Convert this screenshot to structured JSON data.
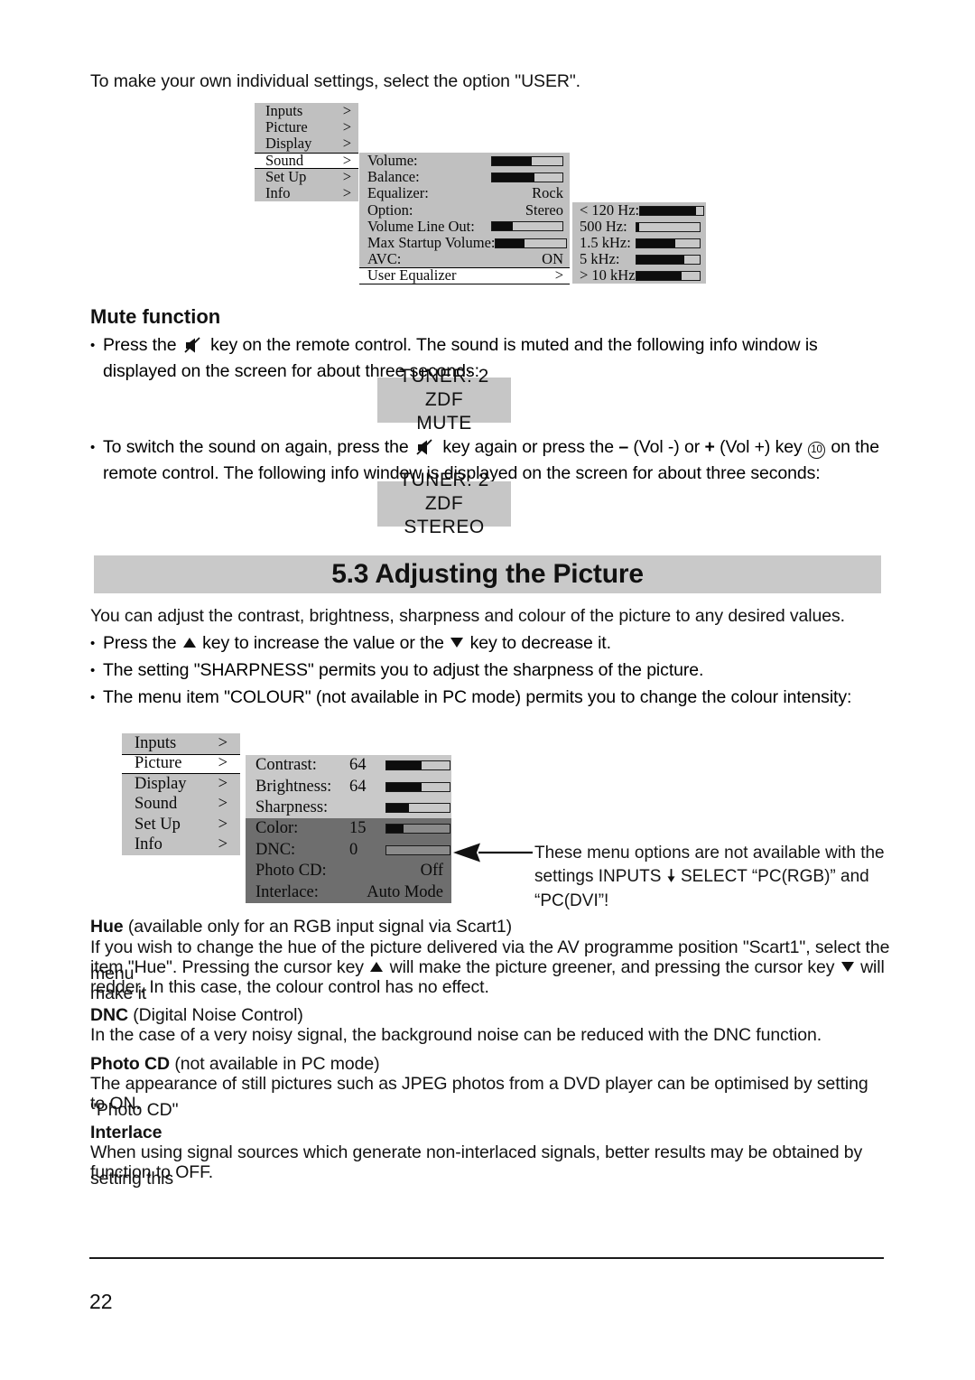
{
  "intro": {
    "line": "To make your own individual settings, select the option \"USER\"."
  },
  "sound_osd": {
    "main_menu": [
      {
        "label": "Inputs",
        "chev": ">"
      },
      {
        "label": "Picture",
        "chev": ">"
      },
      {
        "label": "Display",
        "chev": ">"
      },
      {
        "label": "Sound",
        "chev": ">"
      },
      {
        "label": "Set Up",
        "chev": ">"
      },
      {
        "label": "Info",
        "chev": ">"
      }
    ],
    "selected_item": "Sound",
    "sound_panel": [
      {
        "label": "Volume:",
        "value": "",
        "slider": 56
      },
      {
        "label": "Balance:",
        "value": "",
        "slider": 60
      },
      {
        "label": "Equalizer:",
        "value": "Rock",
        "slider": null
      },
      {
        "label": "Option:",
        "value": "Stereo",
        "slider": null
      },
      {
        "label": "Volume Line Out:",
        "value": "",
        "slider": 30
      },
      {
        "label": "Max Startup Volume:",
        "value": "",
        "slider": 40
      },
      {
        "label": "AVC:",
        "value": "ON",
        "slider": null
      },
      {
        "label": "User Equalizer",
        "value": ">",
        "slider": null,
        "selected": true
      }
    ],
    "equalizer_panel": [
      {
        "label": "< 120 Hz:",
        "slider": 88
      },
      {
        "label": "500 Hz:",
        "slider": 4
      },
      {
        "label": "1.5 kHz:",
        "slider": 62
      },
      {
        "label": "5 kHz:",
        "slider": 75
      },
      {
        "label": "> 10 kHz",
        "slider": 72
      }
    ]
  },
  "mute_section": {
    "heading": "Mute function",
    "bullet1_a": "Press the",
    "bullet1_b": "key on the remote control. The sound is muted and the following info window is displayed on the screen for about three seconds:",
    "mute_window": {
      "line1": "TUNER:  2  ZDF",
      "line2": "MUTE"
    },
    "bullet2_a": "To switch the sound on again, press the",
    "bullet2_b": "key again or press the",
    "bullet2_minus": "–",
    "bullet2_c": "(Vol -) or",
    "bullet2_plus": "+",
    "bullet2_d": "(Vol +) key",
    "bullet2_keynum": "10",
    "bullet2_e": "on the remote control. The following info window is displayed on the screen for about three seconds:",
    "stereo_window": {
      "line1": "TUNER:  2  ZDF",
      "line2": "STEREO"
    }
  },
  "section": {
    "banner_title": "5.3 Adjusting the Picture",
    "intro": "You can adjust the contrast, brightness, sharpness and colour of the picture to any desired values.",
    "b1_a": "Press the",
    "b1_b": "key to increase the value or the",
    "b1_c": "key to decrease it.",
    "b2": "The setting \"SHARPNESS\" permits you to adjust the sharpness of the picture.",
    "b3": "The menu item \"COLOUR\" (not available in PC mode) permits you to change the colour intensity:"
  },
  "picture_osd": {
    "main_menu": [
      {
        "label": "Inputs",
        "chev": ">"
      },
      {
        "label": "Picture",
        "chev": ">"
      },
      {
        "label": "Display",
        "chev": ">"
      },
      {
        "label": "Sound",
        "chev": ">"
      },
      {
        "label": "Set Up",
        "chev": ">"
      },
      {
        "label": "Info",
        "chev": ">"
      }
    ],
    "selected_item": "Picture",
    "panel_top": [
      {
        "label": "Contrast:",
        "value": "64",
        "slider": 55
      },
      {
        "label": "Brightness:",
        "value": "64",
        "slider": 55
      },
      {
        "label": "Sharpness:",
        "value": "",
        "slider": 35
      }
    ],
    "panel_bottom": [
      {
        "label": "Color:",
        "value": "15",
        "slider": 27,
        "text": ""
      },
      {
        "label": "DNC:",
        "value": "0",
        "slider": 0,
        "text": ""
      },
      {
        "label": "Photo CD:",
        "value": "",
        "slider": null,
        "text": "Off"
      },
      {
        "label": "Interlace:",
        "value": "",
        "slider": null,
        "text": "Auto Mode"
      }
    ],
    "callout": {
      "line1": "These menu options are not available with the",
      "line2_a": "settings  INPUTS",
      "line2_b": "SELECT  “PC(RGB)” and",
      "line3": "“PC(DVI”!"
    }
  },
  "notes": {
    "hue_title": "Hue",
    "hue_title_rest": "(available only for an RGB input signal via Scart1)",
    "hue_body_1": "If you wish to change the hue of the picture delivered via the AV programme position \"Scart1\", select the menu",
    "hue_body_2a": "item \"Hue\". Pressing the cursor key",
    "hue_body_2b": "will make the picture greener, and pressing the cursor key",
    "hue_body_2c": "will make it",
    "hue_body_3": "redder. In this case, the colour control has no effect.",
    "dnc_title": "DNC",
    "dnc_title_rest": "(Digital Noise Control)",
    "dnc_body": "In the case of a very noisy signal, the background noise can be reduced with the DNC function.",
    "photocd_title": "Photo CD",
    "photocd_title_rest": "(not available in PC mode)",
    "photocd_body_1": "The appearance of still pictures such as JPEG photos from a DVD player can be optimised by setting \"Photo CD\"",
    "photocd_body_2": "to ON.",
    "interlace_title": "Interlace",
    "interlace_body_1": "When using signal sources which generate non-interlaced signals, better results may be obtained by setting this",
    "interlace_body_2": "function to OFF."
  },
  "footer": {
    "page_number": "22"
  },
  "colors": {
    "osd_gray": "#c0c0c0",
    "osd_dark_gray": "#6e6e6e",
    "banner_gray": "#c9c9c9",
    "slider_fill": "#0d0d0d",
    "text": "#121212"
  }
}
